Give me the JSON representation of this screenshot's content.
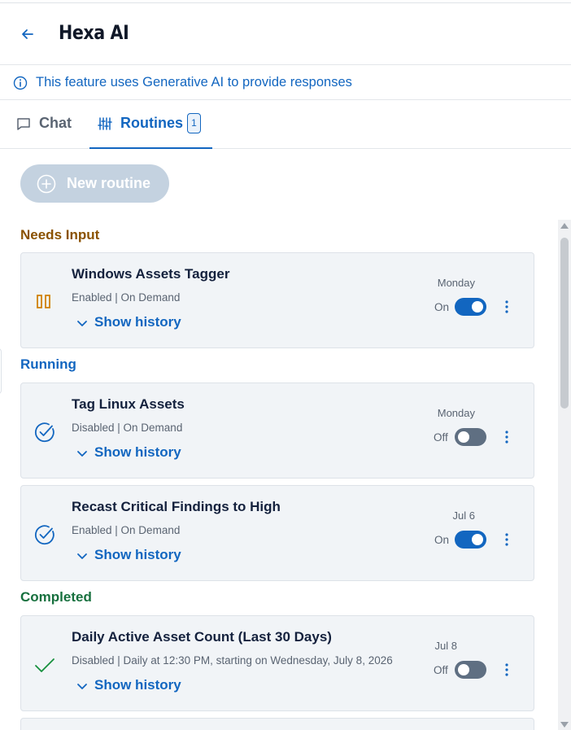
{
  "header": {
    "title": "Hexa AI",
    "back_icon": "arrow-left-icon"
  },
  "notice": {
    "icon": "info-icon",
    "text": "This feature uses Generative AI to provide responses"
  },
  "tabs": [
    {
      "label": "Chat",
      "icon": "chat-bubble-icon",
      "active": false
    },
    {
      "label": "Routines",
      "icon": "sliders-icon",
      "active": true,
      "badge": "1"
    }
  ],
  "new_routine": {
    "label": "New routine",
    "icon": "plus-circle-icon",
    "disabled": true
  },
  "sections": {
    "needs_input": "Needs Input",
    "running": "Running",
    "completed": "Completed"
  },
  "routines": [
    {
      "title": "Windows Assets Tagger",
      "subtitle": "Enabled | On Demand",
      "history_label": "Show history",
      "date": "Monday",
      "toggle_label": "On",
      "enabled": true,
      "status_icon": "pause-icon"
    },
    {
      "title": "Tag Linux Assets",
      "subtitle": "Disabled | On Demand",
      "history_label": "Show history",
      "date": "Monday",
      "toggle_label": "Off",
      "enabled": false,
      "status_icon": "running-check-icon"
    },
    {
      "title": "Recast Critical Findings to High",
      "subtitle": "Enabled | On Demand",
      "history_label": "Show history",
      "date": "Jul 6",
      "toggle_label": "On",
      "enabled": true,
      "status_icon": "running-check-icon"
    },
    {
      "title": "Daily Active Asset Count (Last 30 Days)",
      "subtitle": "Disabled | Daily at 12:30 PM, starting on Wednesday, July 8, 2026",
      "history_label": "Show history",
      "date": "Jul 8",
      "toggle_label": "Off",
      "enabled": false,
      "status_icon": "checkmark-icon"
    }
  ],
  "colors": {
    "accent": "#1266c0",
    "needs_input": "#8a5200",
    "completed": "#17703e",
    "card_bg": "#f1f4f7"
  }
}
